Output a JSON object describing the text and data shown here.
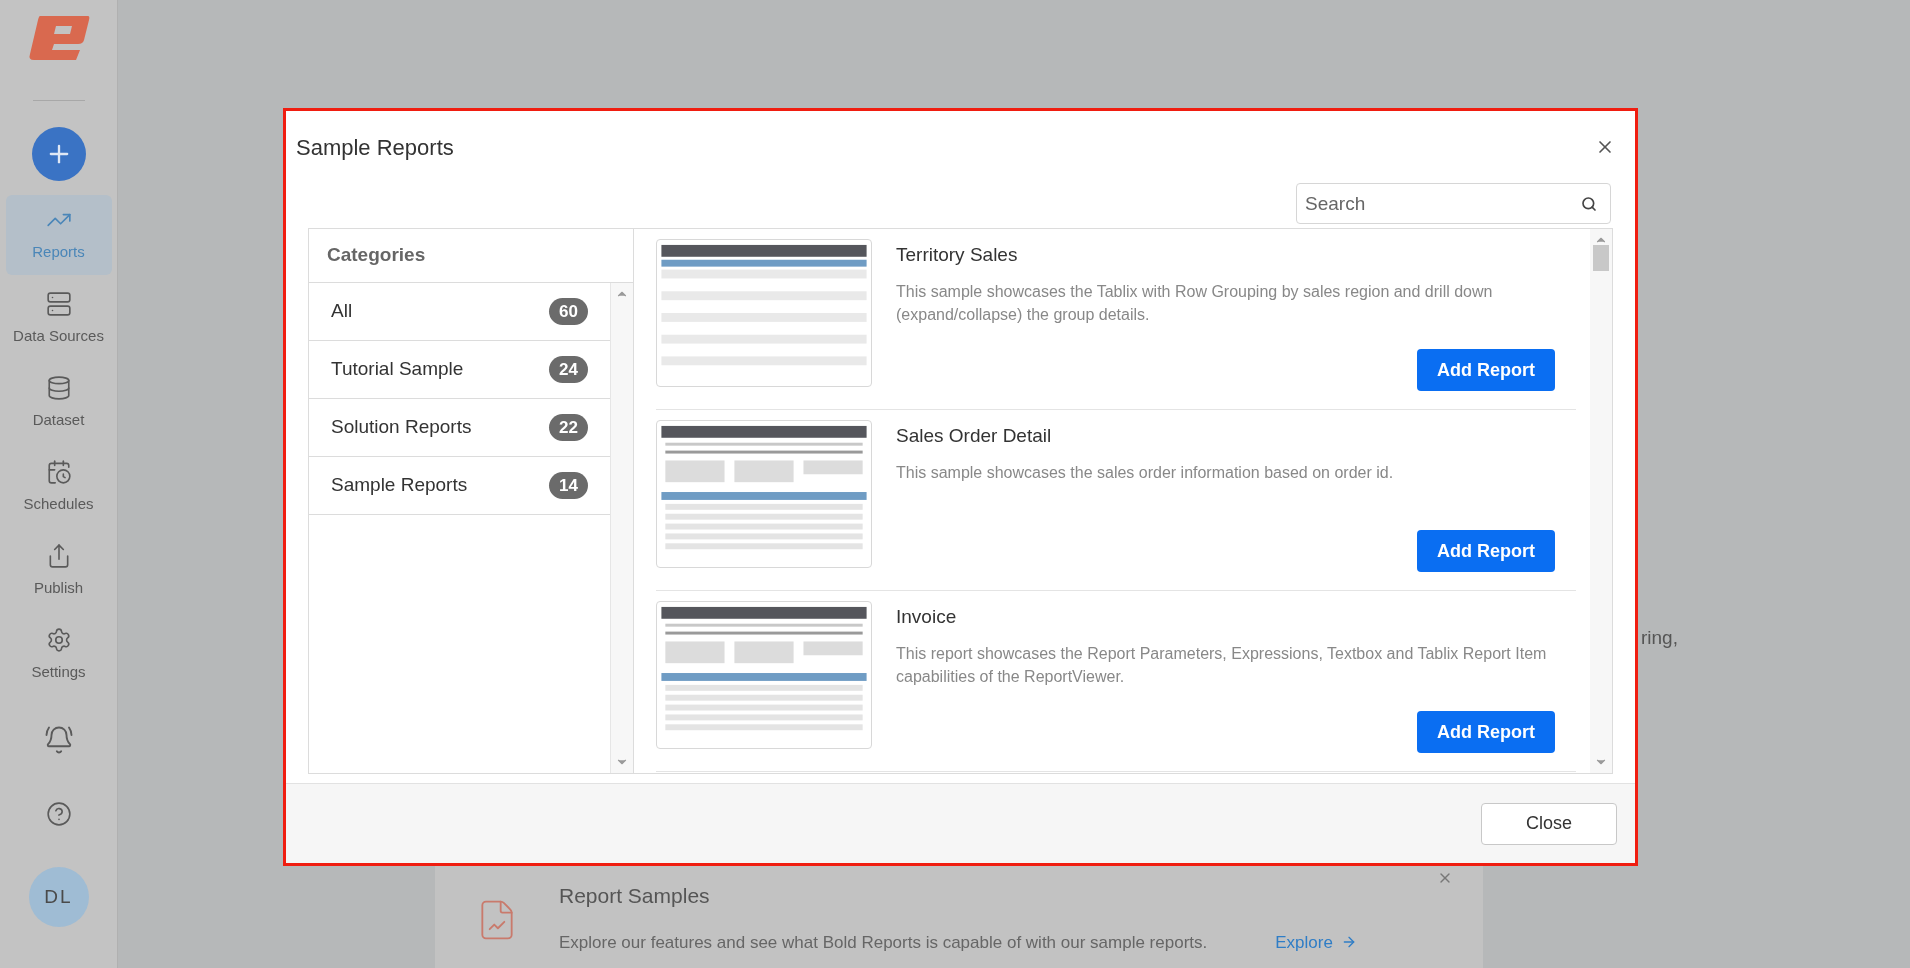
{
  "sidebar": {
    "items": [
      {
        "kind": "reports",
        "label": "Reports",
        "selected": true
      },
      {
        "kind": "data_sources",
        "label": "Data Sources",
        "selected": false
      },
      {
        "kind": "dataset",
        "label": "Dataset",
        "selected": false
      },
      {
        "kind": "schedules",
        "label": "Schedules",
        "selected": false
      },
      {
        "kind": "publish",
        "label": "Publish",
        "selected": false
      },
      {
        "kind": "settings",
        "label": "Settings",
        "selected": false
      }
    ],
    "avatar": "DL"
  },
  "background": {
    "text_fragment": "ring,",
    "card": {
      "title": "Report Samples",
      "description": "Explore our features and see what Bold Reports is capable of with our sample reports.",
      "link": "Explore"
    }
  },
  "dialog": {
    "title": "Sample Reports",
    "search": {
      "placeholder": "Search"
    },
    "categories": {
      "title": "Categories",
      "items": [
        {
          "label": "All",
          "count": "60"
        },
        {
          "label": "Tutorial Sample",
          "count": "24"
        },
        {
          "label": "Solution Reports",
          "count": "22"
        },
        {
          "label": "Sample Reports",
          "count": "14"
        }
      ]
    },
    "reports": [
      {
        "title": "Territory Sales",
        "description": "This sample showcases the Tablix with Row Grouping by sales region and drill down (expand/collapse) the group details.",
        "button": "Add Report"
      },
      {
        "title": "Sales Order Detail",
        "description": "This sample showcases the sales order information based on order id.",
        "button": "Add Report"
      },
      {
        "title": "Invoice",
        "description": "This report showcases the Report Parameters, Expressions, Textbox and Tablix Report Item capabilities of the ReportViewer.",
        "button": "Add Report"
      }
    ],
    "close_button": "Close"
  }
}
